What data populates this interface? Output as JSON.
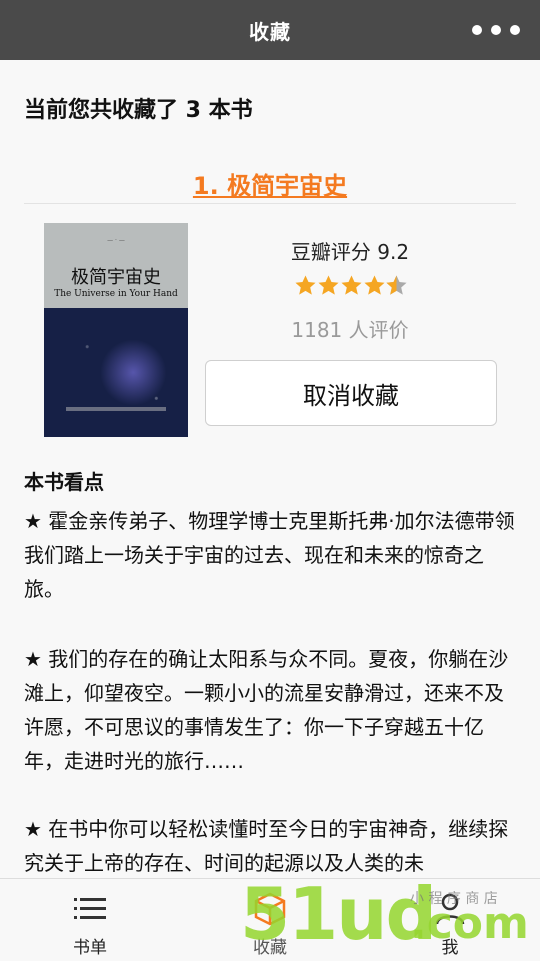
{
  "header": {
    "title": "收藏"
  },
  "summary": {
    "text": "当前您共收藏了 3 本书"
  },
  "book": {
    "title": "1. 极简宇宙史",
    "cover": {
      "title_cn": "极简宇宙史",
      "title_en": "The Universe in Your Hand"
    },
    "rating_text": "豆瓣评分 9.2",
    "rating_value": 9.2,
    "stars": 4.5,
    "count_text": "1181 人评价",
    "cancel_label": "取消收藏"
  },
  "highlights": {
    "heading": "本书看点",
    "paragraphs": [
      "★ 霍金亲传弟子、物理学博士克里斯托弗·加尔法德带领我们踏上一场关于宇宙的过去、现在和未来的惊奇之旅。",
      "★ 我们的存在的确让太阳系与众不同。夏夜，你躺在沙滩上，仰望夜空。一颗小小的流星安静滑过，还来不及许愿，不可思议的事情发生了：你一下子穿越五十亿年，走进时光的旅行……",
      "★ 在书中你可以轻松读懂时至今日的宇宙神奇，继续探究关于上帝的存在、时间的起源以及人类的未"
    ]
  },
  "tabs": [
    {
      "label": "书单",
      "icon": "list-icon"
    },
    {
      "label": "收藏",
      "icon": "box-icon"
    },
    {
      "label": "我",
      "icon": "user-icon"
    }
  ],
  "colors": {
    "accent": "#f47a20",
    "header": "#4a4a4a",
    "star": "#f5a623"
  }
}
